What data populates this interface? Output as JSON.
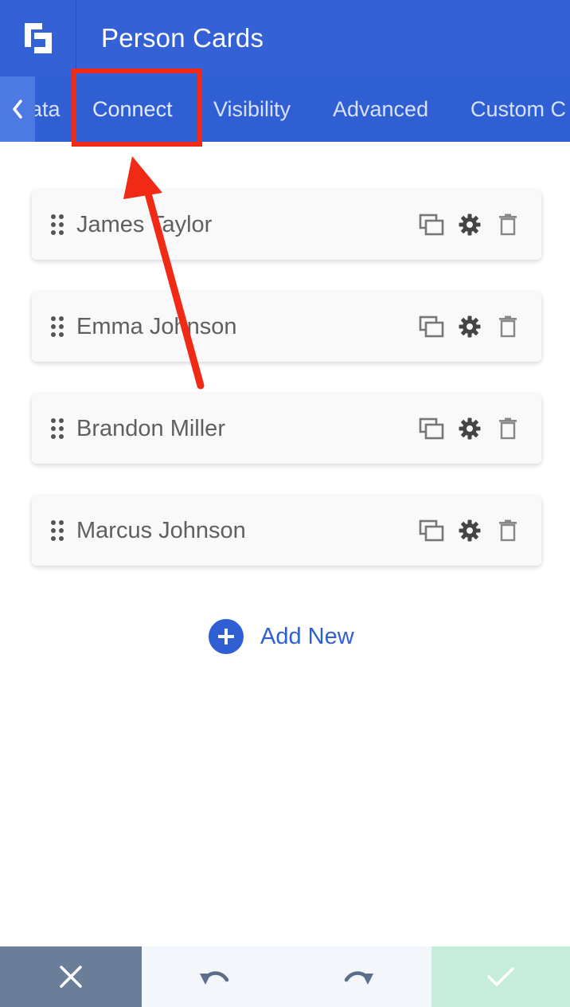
{
  "header": {
    "title": "Person Cards",
    "logo_icon": "divi-logo-icon"
  },
  "tabs": {
    "items": [
      {
        "label": "ata"
      },
      {
        "label": "Connect",
        "active": true
      },
      {
        "label": "Visibility"
      },
      {
        "label": "Advanced"
      },
      {
        "label": "Custom C"
      }
    ]
  },
  "cards": [
    {
      "name": "James Taylor"
    },
    {
      "name": "Emma Johnson"
    },
    {
      "name": "Brandon Miller"
    },
    {
      "name": "Marcus Johnson"
    }
  ],
  "add_new": {
    "label": "Add New"
  },
  "colors": {
    "brand_blue": "#3461d6",
    "tab_bar": "#2f5fd2",
    "annotation_red": "#f02a14",
    "save_green": "#c6ecdc",
    "close_gray": "#6a7d99"
  }
}
